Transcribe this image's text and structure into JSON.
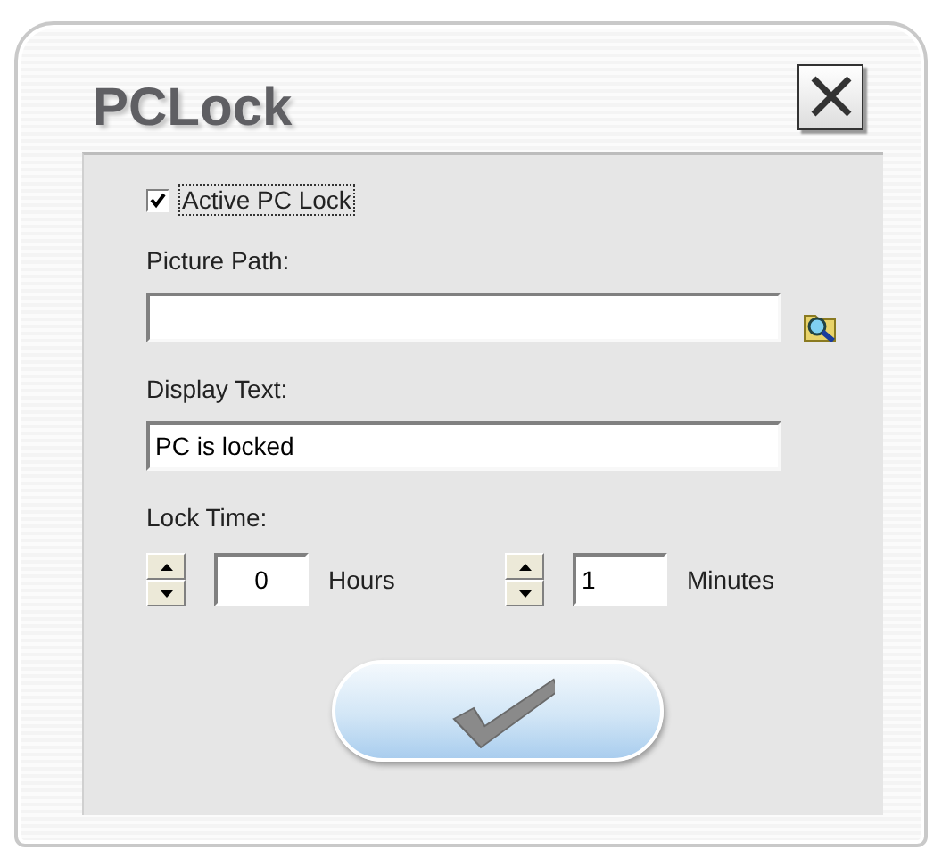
{
  "window": {
    "title": "PCLock"
  },
  "active_checkbox": {
    "label": "Active PC Lock",
    "checked": true
  },
  "picture_path": {
    "label": "Picture Path:"
  },
  "display_text": {
    "label": "Display Text:",
    "value": "PC is locked"
  },
  "lock_time": {
    "label": "Lock Time:",
    "fields": [
      {
        "value": "0",
        "unit": "Hours"
      },
      {
        "value": "1",
        "unit": "Minutes"
      }
    ]
  }
}
